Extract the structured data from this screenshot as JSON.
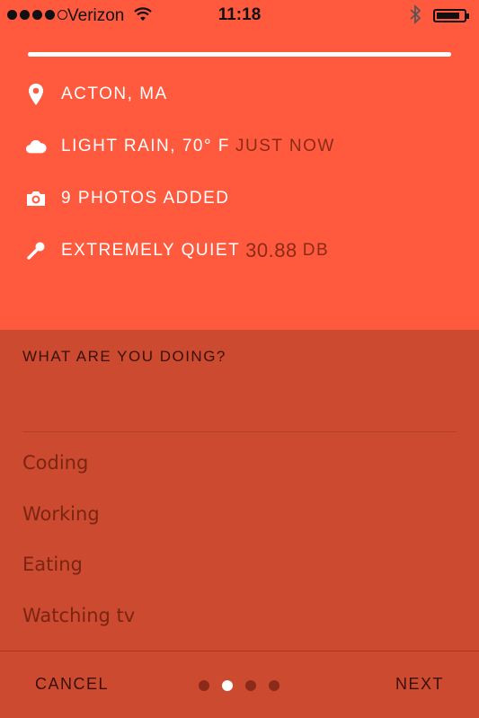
{
  "status_bar": {
    "carrier": "Verizon",
    "time": "11:18",
    "battery_level": 0.85
  },
  "progress": {
    "value": 1.0
  },
  "info": {
    "location": "ACTON, MA",
    "weather": "LIGHT RAIN, 70° F",
    "weather_time": "JUST NOW",
    "photos": "9 PHOTOS ADDED",
    "noise": "EXTREMELY QUIET",
    "noise_value": "30.88",
    "noise_unit": "DB"
  },
  "question": "WHAT ARE YOU DOING?",
  "options": [
    "Coding",
    "Working",
    "Eating",
    "Watching tv"
  ],
  "footer": {
    "cancel": "CANCEL",
    "next": "NEXT",
    "page_count": 4,
    "current_page": 2
  },
  "colors": {
    "background": "#ff5a3e",
    "panel": "#cc4a30",
    "text_dark": "#3a1108",
    "accent_white": "#ffffff"
  },
  "icons": [
    "signal-icon",
    "wifi-icon",
    "bluetooth-icon",
    "battery-icon",
    "location-pin-icon",
    "cloud-icon",
    "camera-icon",
    "microphone-icon"
  ]
}
